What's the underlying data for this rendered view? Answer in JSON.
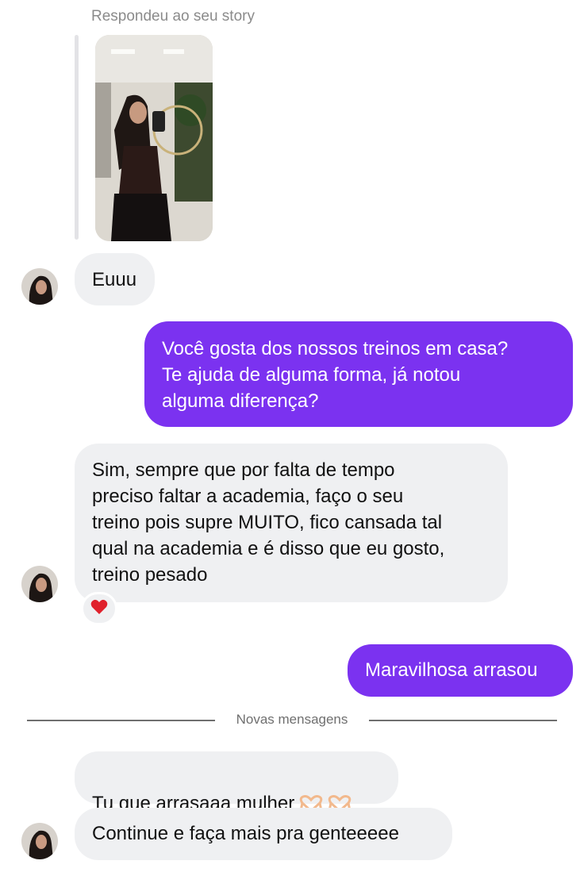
{
  "story_reply": {
    "caption": "Respondeu ao seu story"
  },
  "messages": [
    {
      "id": "m1",
      "direction": "incoming",
      "text": "Euuu"
    },
    {
      "id": "m2",
      "direction": "outgoing",
      "text": "Você gosta dos nossos treinos em casa?\nTe ajuda de alguma forma, já notou\nalguma diferença?"
    },
    {
      "id": "m3",
      "direction": "incoming",
      "text": "Sim, sempre que por falta de tempo\npreciso faltar a academia, faço o seu\ntreino pois supre MUITO, fico cansada tal\nqual na academia e é disso que eu gosto,\ntreino pesado",
      "reaction": "red-heart"
    },
    {
      "id": "m4",
      "direction": "outgoing",
      "text": "Maravilhosa arrasou"
    },
    {
      "id": "m5",
      "direction": "incoming",
      "text": "Tu que arrasaaa mulher",
      "trailing_emoji": [
        "heart-hands",
        "heart-hands"
      ]
    },
    {
      "id": "m6",
      "direction": "incoming",
      "text": "Continue e faça mais pra genteeeee"
    }
  ],
  "divider": {
    "label": "Novas mensagens"
  },
  "colors": {
    "outgoing_bubble": "#7b32f0",
    "incoming_bubble": "#eff0f2",
    "caption_text": "#8b8b8b"
  }
}
